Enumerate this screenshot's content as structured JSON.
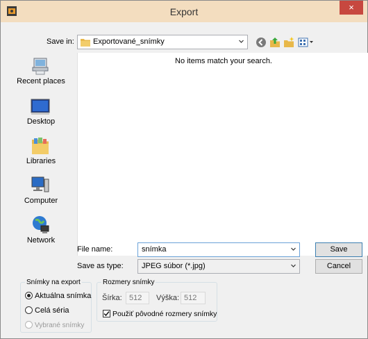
{
  "window": {
    "title": "Export",
    "close_glyph": "×"
  },
  "save_in": {
    "label": "Save in:",
    "folder": "Exportované_snímky"
  },
  "toolbar": {
    "icons": [
      "back-icon",
      "up-folder-icon",
      "new-folder-icon",
      "view-menu-icon"
    ]
  },
  "places": [
    {
      "label": "Recent places",
      "icon": "recent-places-icon"
    },
    {
      "label": "Desktop",
      "icon": "desktop-icon"
    },
    {
      "label": "Libraries",
      "icon": "libraries-icon"
    },
    {
      "label": "Computer",
      "icon": "computer-icon"
    },
    {
      "label": "Network",
      "icon": "network-icon"
    }
  ],
  "file_list": {
    "empty_message": "No items match your search."
  },
  "file_name": {
    "label": "File name:",
    "value": "snímka"
  },
  "save_as_type": {
    "label": "Save as type:",
    "value": "JPEG súbor (*.jpg)"
  },
  "buttons": {
    "save": "Save",
    "cancel": "Cancel"
  },
  "export_group": {
    "legend": "Snímky na export",
    "options": [
      {
        "label": "Aktuálna snímka",
        "selected": true,
        "enabled": true
      },
      {
        "label": "Celá séria",
        "selected": false,
        "enabled": true
      },
      {
        "label": "Vybrané snímky",
        "selected": false,
        "enabled": false
      }
    ]
  },
  "size_group": {
    "legend": "Rozmery snímky",
    "width_label": "Šírka:",
    "width_value": "512",
    "height_label": "Výška:",
    "height_value": "512",
    "original_size_label": "Použiť pôvodné rozmery snímky",
    "original_size_checked": true
  },
  "colors": {
    "titlebar": "#f3ddbf",
    "close": "#c7483f",
    "folder": "#e8b84a",
    "accent": "#3c7fb1"
  }
}
